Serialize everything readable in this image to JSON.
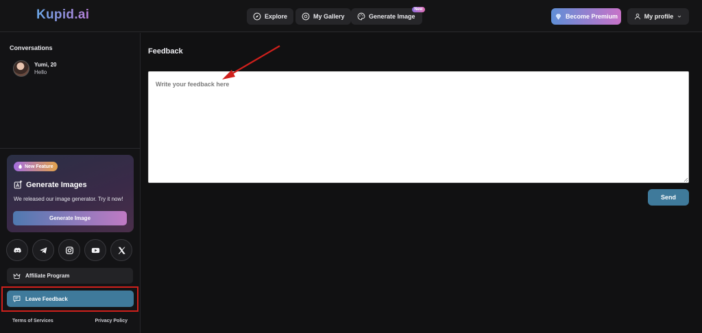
{
  "header": {
    "logo": "Kupid.ai",
    "nav": [
      {
        "label": "Explore",
        "icon": "compass-icon"
      },
      {
        "label": "My Gallery",
        "icon": "gallery-icon"
      },
      {
        "label": "Generate Image",
        "icon": "palette-icon",
        "badge": "New"
      }
    ],
    "premium_label": "Become Premium",
    "profile_label": "My profile"
  },
  "sidebar": {
    "conversations_title": "Conversations",
    "conversations": [
      {
        "name": "Yumi, 20",
        "message": "Hello"
      }
    ],
    "promo": {
      "badge": "New Feature",
      "title": "Generate Images",
      "text": "We released our image generator. Try it now!",
      "button": "Generate Image"
    },
    "socials": [
      "discord-icon",
      "telegram-icon",
      "instagram-icon",
      "youtube-icon",
      "x-icon"
    ],
    "affiliate_label": "Affiliate Program",
    "feedback_label": "Leave Feedback",
    "footer": {
      "terms": "Terms of Services",
      "privacy": "Privacy Policy"
    }
  },
  "main": {
    "title": "Feedback",
    "placeholder": "Write your feedback here",
    "send_label": "Send"
  },
  "colors": {
    "background": "#111112",
    "accent": "#3f7a9b",
    "annotation": "#d0201c"
  }
}
